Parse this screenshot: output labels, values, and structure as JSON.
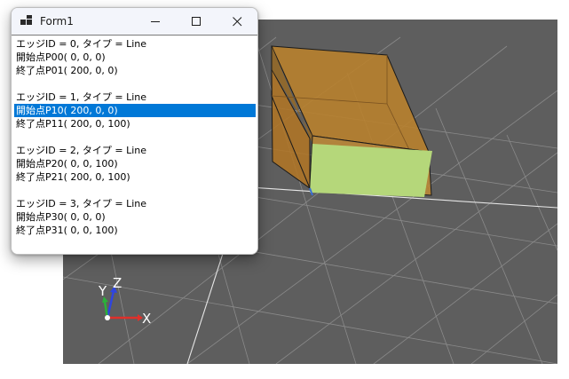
{
  "window": {
    "title": "Form1"
  },
  "list_items": [
    "エッジID = 0, タイプ = Line",
    "開始点P00( 0, 0, 0)",
    "終了点P01( 200, 0, 0)",
    "",
    "エッジID = 1, タイプ = Line",
    "開始点P10( 200, 0, 0)",
    "終了点P11( 200, 0, 100)",
    "",
    "エッジID = 2, タイプ = Line",
    "開始点P20( 0, 0, 100)",
    "終了点P21( 200, 0, 100)",
    "",
    "エッジID = 3, タイプ = Line",
    "開始点P30( 0, 0, 0)",
    "終了点P31( 0, 0, 100)"
  ],
  "selected_index": 5,
  "axes": {
    "x": "X",
    "y": "Y",
    "z": "Z"
  },
  "colors": {
    "viewport_bg": "#5e5e5e",
    "box_fill": "#c8882a",
    "selected_face": "#b5d77a",
    "selection": "#0078d7",
    "axis_x": "#e0302a",
    "axis_y": "#2bb13a",
    "axis_z": "#2f45e0"
  }
}
